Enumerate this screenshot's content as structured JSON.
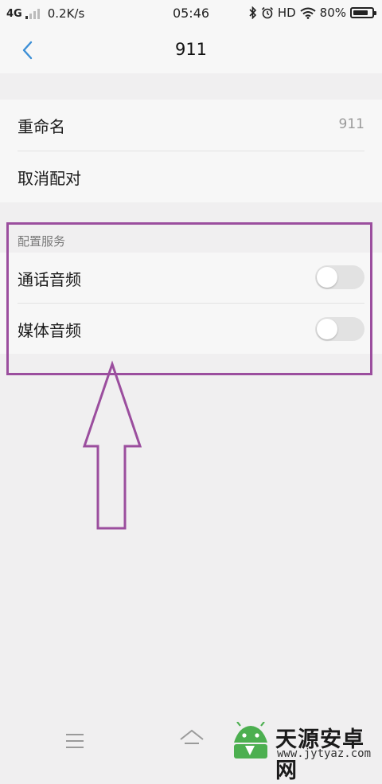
{
  "status_bar": {
    "network": "4G",
    "speed": "0.2K/s",
    "time": "05:46",
    "hd": "HD",
    "battery_text": "80%",
    "battery_level": 0.8
  },
  "header": {
    "title": "911",
    "back_icon": "chevron-left-icon"
  },
  "device": {
    "rename_label": "重命名",
    "rename_value": "911",
    "unpair_label": "取消配对"
  },
  "services": {
    "section_title": "配置服务",
    "items": [
      {
        "label": "通话音频",
        "enabled": false
      },
      {
        "label": "媒体音频",
        "enabled": false
      }
    ]
  },
  "annotation": {
    "color": "#9b4e9e"
  },
  "nav": {
    "menu_icon": "menu-icon",
    "home_icon": "home-icon"
  },
  "watermark": {
    "title": "天源安卓网",
    "url": "www.jytyaz.com"
  },
  "colors": {
    "accent": "#3c8fd6",
    "background": "#f0eff0",
    "card": "#f7f7f7",
    "toggle_off": "#e2e2e2"
  }
}
